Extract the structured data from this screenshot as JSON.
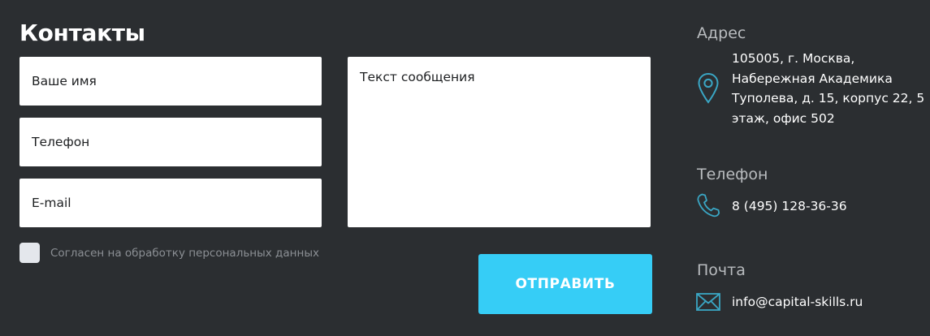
{
  "contacts": {
    "title": "Контакты"
  },
  "form": {
    "name_placeholder": "Ваше имя",
    "phone_placeholder": "Телефон",
    "email_placeholder": "E-mail",
    "message_placeholder": "Текст сообщения",
    "consent_label": "Согласен на обработку персональных данных",
    "submit_label": "ОТПРАВИТЬ"
  },
  "info": {
    "address": {
      "title": "Адрес",
      "icon": "map-pin-icon",
      "text": "105005, г. Москва, Набережная Академика Туполева, д. 15, корпус 22, 5 этаж, офис 502"
    },
    "phone": {
      "title": "Телефон",
      "icon": "phone-icon",
      "text": "8 (495) 128-36-36"
    },
    "mail": {
      "title": "Почта",
      "icon": "envelope-icon",
      "text": "info@capital-skills.ru"
    }
  },
  "colors": {
    "background": "#2b2e31",
    "accent": "#36cdf6",
    "icon": "#3aa6c4"
  }
}
